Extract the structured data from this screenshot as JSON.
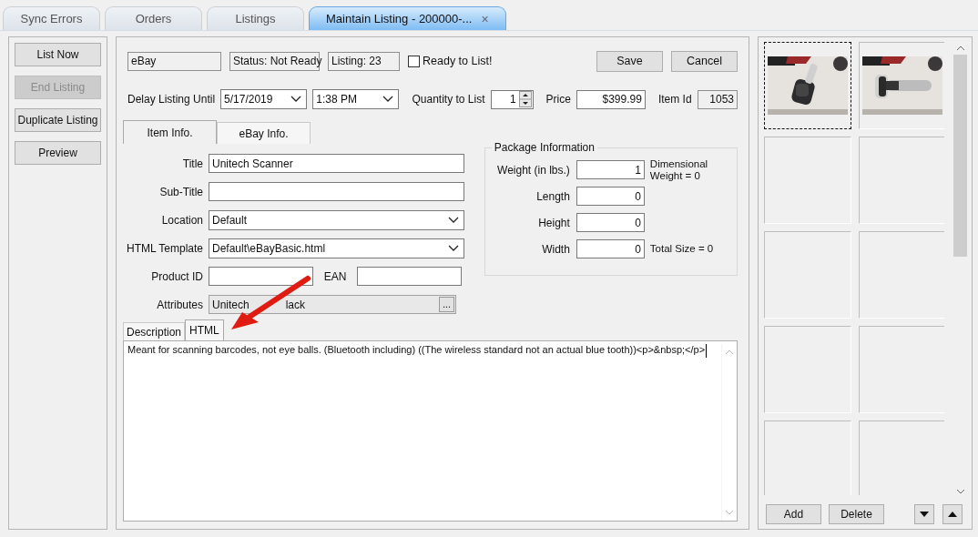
{
  "tabs": [
    {
      "label": "Sync Errors",
      "selected": false
    },
    {
      "label": "Orders",
      "selected": false
    },
    {
      "label": "Listings",
      "selected": false
    },
    {
      "label": "Maintain Listing - 200000-...",
      "selected": true,
      "close": "×"
    }
  ],
  "actions": [
    {
      "label": "List Now",
      "disabled": false
    },
    {
      "label": "End Listing",
      "disabled": true
    },
    {
      "label": "Duplicate Listing",
      "disabled": false
    },
    {
      "label": "Preview",
      "disabled": false
    }
  ],
  "header": {
    "marketplace": "eBay",
    "status": "Status: Not Ready",
    "listing": "Listing: 23",
    "ready": {
      "label": "Ready to List!",
      "checked": false
    },
    "buttons": [
      "Save",
      "Cancel"
    ]
  },
  "schedule": {
    "label": "Delay Listing Until",
    "date": "5/17/2019",
    "time": "1:38 PM",
    "quantity_label": "Quantity to List",
    "quantity": "1",
    "price_label": "Price",
    "price": "$399.99",
    "item_id_label": "Item Id",
    "item_id": "1053"
  },
  "detail_tabs": [
    {
      "label": "Item Info.",
      "selected": true
    },
    {
      "label": "eBay Info.",
      "selected": false
    }
  ],
  "fields": [
    {
      "kind": "text",
      "label": "Title",
      "value": "Unitech Scanner"
    },
    {
      "kind": "text",
      "label": "Sub-Title"
    },
    {
      "kind": "dropdown",
      "label": "Location",
      "value": "Default"
    },
    {
      "kind": "dropdown",
      "label": "HTML Template",
      "value": "Default\\eBayBasic.html"
    },
    {
      "kind": "pair",
      "label": "Product ID",
      "second_label": "EAN"
    },
    {
      "kind": "browse",
      "label": "Attributes",
      "value": "Unitech",
      "value_tail": "lack",
      "button": "..."
    }
  ],
  "package": {
    "title": "Package Information",
    "rows": [
      {
        "label": "Weight (in lbs.)",
        "value": "1",
        "note": "Dimensional Weight = 0"
      },
      {
        "label": "Length",
        "value": "0"
      },
      {
        "label": "Height",
        "value": "0"
      },
      {
        "label": "Width",
        "value": "0",
        "note": "Total Size = 0"
      }
    ]
  },
  "editor_tabs": [
    {
      "label": "Description",
      "selected": false
    },
    {
      "label": "HTML",
      "selected": true
    }
  ],
  "editor": {
    "value": "Meant for scanning barcodes, not eye balls. (Bluetooth including) ((The wireless standard not an actual blue tooth))<p>&nbsp;</p>"
  },
  "images": [
    {
      "kind": "picture",
      "selected": true
    },
    {
      "kind": "picture",
      "selected": false
    },
    {
      "kind": "empty",
      "selected": false
    },
    {
      "kind": "empty",
      "selected": false
    },
    {
      "kind": "empty",
      "selected": false
    },
    {
      "kind": "empty",
      "selected": false
    },
    {
      "kind": "empty",
      "selected": false
    },
    {
      "kind": "empty",
      "selected": false
    },
    {
      "kind": "empty",
      "selected": false
    },
    {
      "kind": "empty",
      "selected": false
    }
  ],
  "image_buttons": [
    "Add",
    "Delete"
  ]
}
